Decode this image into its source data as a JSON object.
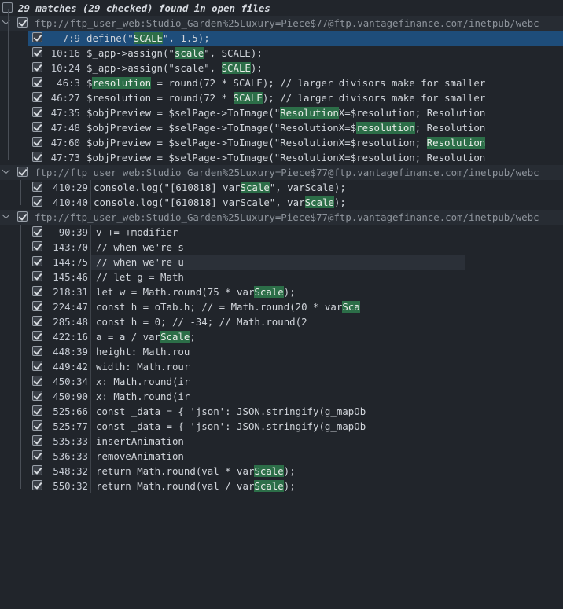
{
  "header": {
    "text": "29 matches (29 checked) found in open files"
  },
  "groups": [
    {
      "file": "ftp://ftp_user_web:Studio_Garden%25Luxury=Piece$77@ftp.vantagefinance.com/inetpub/webc",
      "items": [
        {
          "loc": "7:9",
          "pre": "define(\"",
          "hl": "SCALE",
          "post": "\", 1.5);"
        },
        {
          "loc": "10:16",
          "pre": "$_app->assign(\"",
          "hl": "scale",
          "post": "\", SCALE);"
        },
        {
          "loc": "10:24",
          "pre": "$_app->assign(\"scale\", ",
          "hl": "SCALE",
          "post": ");"
        },
        {
          "loc": "46:3",
          "pre": "$",
          "hl": "resolution",
          "post": " = round(72 * SCALE); // larger divisors make for smaller"
        },
        {
          "loc": "46:27",
          "pre": "$resolution = round(72 * ",
          "hl": "SCALE",
          "post": "); // larger divisors make for smaller"
        },
        {
          "loc": "47:35",
          "pre": "$objPreview = $selPage->ToImage(\"",
          "hl": "Resolution",
          "post": "X=$resolution; Resolution"
        },
        {
          "loc": "47:48",
          "pre": "$objPreview = $selPage->ToImage(\"ResolutionX=$",
          "hl": "resolution",
          "post": "; Resolution"
        },
        {
          "loc": "47:60",
          "pre": "$objPreview = $selPage->ToImage(\"ResolutionX=$resolution; ",
          "hl": "Resolution",
          "post": ""
        },
        {
          "loc": "47:73",
          "pre": "$objPreview = $selPage->ToImage(\"ResolutionX=$resolution; Resolution",
          "hl": "",
          "post": ""
        }
      ]
    },
    {
      "file": "ftp://ftp_user_web:Studio_Garden%25Luxury=Piece$77@ftp.vantagefinance.com/inetpub/webc",
      "items": [
        {
          "loc": "410:29",
          "pre": "console.log(\"[610818] var",
          "hl": "Scale",
          "post": "\", varScale);"
        },
        {
          "loc": "410:40",
          "pre": "console.log(\"[610818] varScale\", var",
          "hl": "Scale",
          "post": ");"
        }
      ]
    },
    {
      "file": "ftp://ftp_user_web:Studio_Garden%25Luxury=Piece$77@ftp.vantagefinance.com/inetpub/webc",
      "items": [
        {
          "loc": "90:39",
          "pre": "v += +modifier ",
          "hl": "",
          "post": ""
        },
        {
          "loc": "143:70",
          "pre": "// when we're s",
          "hl": "",
          "post": ""
        },
        {
          "loc": "144:75",
          "pre": "// when we're u",
          "hl": "",
          "post": ""
        },
        {
          "loc": "145:46",
          "pre": "// let g = Math",
          "hl": "",
          "post": ""
        },
        {
          "loc": "218:31",
          "pre": "let w = Math.round(75 * var",
          "hl": "Scale",
          "post": ");"
        },
        {
          "loc": "224:47",
          "pre": "const h = oTab.h; //  = Math.round(20 * var",
          "hl": "Sca",
          "post": ""
        },
        {
          "loc": "285:48",
          "pre": "const h = 0; // -34; // Math.round(2",
          "hl": "",
          "post": ""
        },
        {
          "loc": "422:16",
          "pre": "a = a / var",
          "hl": "Scale",
          "post": ";"
        },
        {
          "loc": "448:39",
          "pre": "height: Math.rou",
          "hl": "",
          "post": ""
        },
        {
          "loc": "449:42",
          "pre": "width: Math.rour",
          "hl": "",
          "post": ""
        },
        {
          "loc": "450:34",
          "pre": "x: Math.round(ir",
          "hl": "",
          "post": ""
        },
        {
          "loc": "450:90",
          "pre": "x: Math.round(ir",
          "hl": "",
          "post": ""
        },
        {
          "loc": "525:66",
          "pre": "const _data = { 'json': JSON.stringify(g_mapOb",
          "hl": "",
          "post": ""
        },
        {
          "loc": "525:77",
          "pre": "const _data = { 'json': JSON.stringify(g_mapOb",
          "hl": "",
          "post": ""
        },
        {
          "loc": "535:33",
          "pre": "insertAnimation",
          "hl": "",
          "post": ""
        },
        {
          "loc": "536:33",
          "pre": "removeAnimation",
          "hl": "",
          "post": ""
        },
        {
          "loc": "548:32",
          "pre": "return Math.round(val * var",
          "hl": "Scale",
          "post": ");"
        },
        {
          "loc": "550:32",
          "pre": "return Math.round(val / var",
          "hl": "Scale",
          "post": ");"
        }
      ]
    }
  ]
}
